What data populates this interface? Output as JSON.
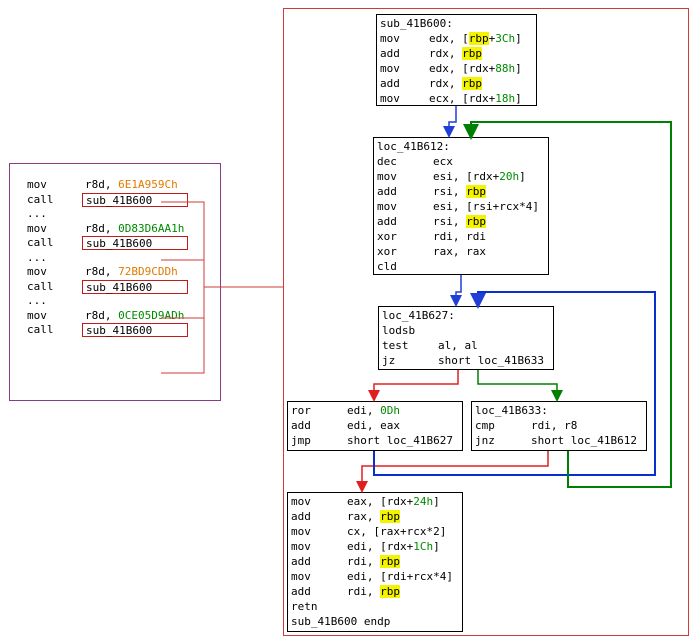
{
  "caller": {
    "lines": [
      {
        "kind": "ins",
        "mnem": "mov",
        "ops": [
          {
            "t": "r8d, "
          },
          {
            "t": "6E1A959Ch",
            "c": "orange"
          }
        ]
      },
      {
        "kind": "call",
        "mnem": "call",
        "target": "sub_41B600"
      },
      {
        "kind": "dots",
        "text": "..."
      },
      {
        "kind": "ins",
        "mnem": "mov",
        "ops": [
          {
            "t": "r8d, "
          },
          {
            "t": "0D83D6AA1h",
            "c": "green"
          }
        ]
      },
      {
        "kind": "call",
        "mnem": "call",
        "target": "sub_41B600"
      },
      {
        "kind": "dots",
        "text": "..."
      },
      {
        "kind": "ins",
        "mnem": "mov",
        "ops": [
          {
            "t": "r8d, "
          },
          {
            "t": "72BD9CDDh",
            "c": "orange"
          }
        ]
      },
      {
        "kind": "call",
        "mnem": "call",
        "target": "sub_41B600"
      },
      {
        "kind": "dots",
        "text": "..."
      },
      {
        "kind": "ins",
        "mnem": "mov",
        "ops": [
          {
            "t": "r8d, "
          },
          {
            "t": "0CE05D9ADh",
            "c": "green"
          }
        ]
      },
      {
        "kind": "call",
        "mnem": "call",
        "target": "sub_41B600"
      }
    ]
  },
  "blocks": {
    "b1": {
      "lines": [
        {
          "kind": "label",
          "text": "sub_41B600:"
        },
        {
          "kind": "ins",
          "mnem": "mov",
          "ops": [
            {
              "t": "edx, ["
            },
            {
              "t": "rbp",
              "c": "hl"
            },
            {
              "t": "+"
            },
            {
              "t": "3Ch",
              "c": "green"
            },
            {
              "t": "]"
            }
          ]
        },
        {
          "kind": "ins",
          "mnem": "add",
          "ops": [
            {
              "t": "rdx, "
            },
            {
              "t": "rbp",
              "c": "hl"
            }
          ]
        },
        {
          "kind": "ins",
          "mnem": "mov",
          "ops": [
            {
              "t": "edx, [rdx+"
            },
            {
              "t": "88h",
              "c": "green"
            },
            {
              "t": "]"
            }
          ]
        },
        {
          "kind": "ins",
          "mnem": "add",
          "ops": [
            {
              "t": "rdx, "
            },
            {
              "t": "rbp",
              "c": "hl"
            }
          ]
        },
        {
          "kind": "ins",
          "mnem": "mov",
          "ops": [
            {
              "t": "ecx, [rdx+"
            },
            {
              "t": "18h",
              "c": "green"
            },
            {
              "t": "]"
            }
          ]
        }
      ]
    },
    "b2": {
      "lines": [
        {
          "kind": "label",
          "text": "loc_41B612:"
        },
        {
          "kind": "ins",
          "mnem": "dec",
          "ops": [
            {
              "t": "ecx"
            }
          ]
        },
        {
          "kind": "ins",
          "mnem": "mov",
          "ops": [
            {
              "t": "esi, [rdx+"
            },
            {
              "t": "20h",
              "c": "green"
            },
            {
              "t": "]"
            }
          ]
        },
        {
          "kind": "ins",
          "mnem": "add",
          "ops": [
            {
              "t": "rsi, "
            },
            {
              "t": "rbp",
              "c": "hl"
            }
          ]
        },
        {
          "kind": "ins",
          "mnem": "mov",
          "ops": [
            {
              "t": "esi, [rsi+rcx*4]"
            }
          ]
        },
        {
          "kind": "ins",
          "mnem": "add",
          "ops": [
            {
              "t": "rsi, "
            },
            {
              "t": "rbp",
              "c": "hl"
            }
          ]
        },
        {
          "kind": "ins",
          "mnem": "xor",
          "ops": [
            {
              "t": "rdi, rdi"
            }
          ]
        },
        {
          "kind": "ins",
          "mnem": "xor",
          "ops": [
            {
              "t": "rax, rax"
            }
          ]
        },
        {
          "kind": "ins",
          "mnem": "cld",
          "ops": []
        }
      ]
    },
    "b3": {
      "lines": [
        {
          "kind": "label",
          "text": "loc_41B627:"
        },
        {
          "kind": "ins",
          "mnem": "lodsb",
          "ops": []
        },
        {
          "kind": "ins",
          "mnem": "test",
          "ops": [
            {
              "t": "al, al"
            }
          ]
        },
        {
          "kind": "ins",
          "mnem": "jz",
          "ops": [
            {
              "t": "short loc_41B633"
            }
          ]
        }
      ]
    },
    "b4": {
      "lines": [
        {
          "kind": "ins",
          "mnem": "ror",
          "ops": [
            {
              "t": "edi, "
            },
            {
              "t": "0Dh",
              "c": "green"
            }
          ]
        },
        {
          "kind": "ins",
          "mnem": "add",
          "ops": [
            {
              "t": "edi, eax"
            }
          ]
        },
        {
          "kind": "ins",
          "mnem": "jmp",
          "ops": [
            {
              "t": "short loc_41B627"
            }
          ]
        }
      ]
    },
    "b5": {
      "lines": [
        {
          "kind": "label",
          "text": "loc_41B633:"
        },
        {
          "kind": "ins",
          "mnem": "cmp",
          "ops": [
            {
              "t": "rdi, r8"
            }
          ]
        },
        {
          "kind": "ins",
          "mnem": "jnz",
          "ops": [
            {
              "t": "short loc_41B612"
            }
          ]
        }
      ]
    },
    "b6": {
      "lines": [
        {
          "kind": "ins",
          "mnem": "mov",
          "ops": [
            {
              "t": "eax, [rdx+"
            },
            {
              "t": "24h",
              "c": "green"
            },
            {
              "t": "]"
            }
          ]
        },
        {
          "kind": "ins",
          "mnem": "add",
          "ops": [
            {
              "t": "rax, "
            },
            {
              "t": "rbp",
              "c": "hl"
            }
          ]
        },
        {
          "kind": "ins",
          "mnem": "mov",
          "ops": [
            {
              "t": "cx, [rax+rcx*2]"
            }
          ]
        },
        {
          "kind": "ins",
          "mnem": "mov",
          "ops": [
            {
              "t": "edi, [rdx+"
            },
            {
              "t": "1Ch",
              "c": "green"
            },
            {
              "t": "]"
            }
          ]
        },
        {
          "kind": "ins",
          "mnem": "add",
          "ops": [
            {
              "t": "rdi, "
            },
            {
              "t": "rbp",
              "c": "hl"
            }
          ]
        },
        {
          "kind": "ins",
          "mnem": "mov",
          "ops": [
            {
              "t": "edi, [rdi+rcx*4]"
            }
          ]
        },
        {
          "kind": "ins",
          "mnem": "add",
          "ops": [
            {
              "t": "rdi, "
            },
            {
              "t": "rbp",
              "c": "hl"
            }
          ]
        },
        {
          "kind": "ins",
          "mnem": "retn",
          "ops": []
        },
        {
          "kind": "label",
          "text": "sub_41B600 endp"
        }
      ]
    }
  },
  "colors": {
    "edge_seq": "#1f3fd6",
    "edge_true": "#008000",
    "edge_false": "#e02020",
    "edge_loop": "#0a2fd0",
    "xref": "#d23b3b",
    "highlight": "#f4f400",
    "immediate": "#008a00",
    "constant": "#e07b00"
  }
}
